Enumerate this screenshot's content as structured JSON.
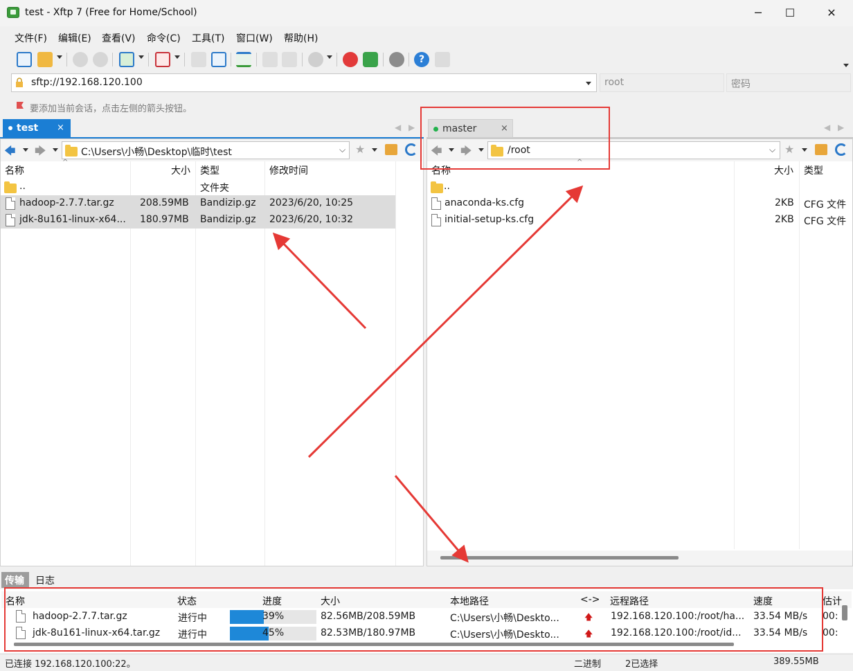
{
  "window": {
    "title": "test - Xftp 7 (Free for Home/School)",
    "minimize": "─",
    "maximize": "☐",
    "close": "✕"
  },
  "menu": [
    "文件(F)",
    "编辑(E)",
    "查看(V)",
    "命令(C)",
    "工具(T)",
    "窗口(W)",
    "帮助(H)"
  ],
  "address": {
    "value": "sftp://192.168.120.100",
    "user_placeholder": "root",
    "pass_placeholder": "密码"
  },
  "hint": "要添加当前会话，点击左侧的箭头按钮。",
  "local": {
    "tab": "test",
    "tab_close": "×",
    "path": "C:\\Users\\小畅\\Desktop\\临时\\test",
    "columns": [
      "名称",
      "大小",
      "类型",
      "修改时间"
    ],
    "rows": [
      {
        "name": "..",
        "size": "",
        "type": "文件夹",
        "date": ""
      },
      {
        "name": "hadoop-2.7.7.tar.gz",
        "size": "208.59MB",
        "type": "Bandizip.gz",
        "date": "2023/6/20, 10:25"
      },
      {
        "name": "jdk-8u161-linux-x64...",
        "size": "180.97MB",
        "type": "Bandizip.gz",
        "date": "2023/6/20, 10:32"
      }
    ]
  },
  "remote": {
    "tab": "master",
    "tab_close": "×",
    "path": "/root",
    "columns": [
      "名称",
      "大小",
      "类型"
    ],
    "rows": [
      {
        "name": "..",
        "size": "",
        "type": ""
      },
      {
        "name": "anaconda-ks.cfg",
        "size": "2KB",
        "type": "CFG 文件"
      },
      {
        "name": "initial-setup-ks.cfg",
        "size": "2KB",
        "type": "CFG 文件"
      }
    ]
  },
  "bottom_tabs": [
    "传输",
    "日志"
  ],
  "transfers": {
    "columns": [
      "名称",
      "状态",
      "进度",
      "大小",
      "本地路径",
      "<->",
      "远程路径",
      "速度",
      "估计"
    ],
    "rows": [
      {
        "name": "hadoop-2.7.7.tar.gz",
        "status": "进行中",
        "progress": "39%",
        "progress_value": 39,
        "size": "82.56MB/208.59MB",
        "local": "C:\\Users\\小畅\\Deskto...",
        "remote": "192.168.120.100:/root/ha...",
        "speed": "33.54 MB/s",
        "eta": "00:"
      },
      {
        "name": "jdk-8u161-linux-x64.tar.gz",
        "status": "进行中",
        "progress": "45%",
        "progress_value": 45,
        "size": "82.53MB/180.97MB",
        "local": "C:\\Users\\小畅\\Deskto...",
        "remote": "192.168.120.100:/root/id...",
        "speed": "33.54 MB/s",
        "eta": "00:"
      }
    ]
  },
  "status": {
    "connection": "已连接 192.168.120.100:22。",
    "mode": "二进制",
    "selected": "2已选择",
    "total": "389.55MB"
  },
  "colors": {
    "accent": "#1b7ed4",
    "annotation": "#e53935",
    "progress": "#1e88d8"
  }
}
